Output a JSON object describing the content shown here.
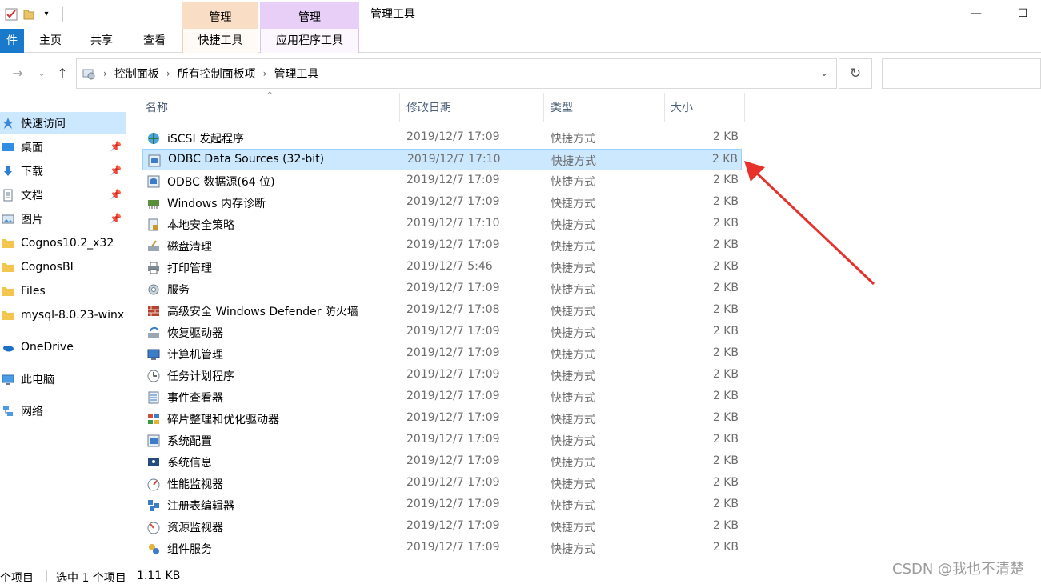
{
  "window": {
    "title": "管理工具",
    "context_tab_manage_1": "管理",
    "context_tab_manage_2": "管理",
    "minimize_glyph": "—",
    "maximize_glyph": "☐"
  },
  "ribbon": {
    "tabs": [
      {
        "label": "件"
      },
      {
        "label": "主页"
      },
      {
        "label": "共享"
      },
      {
        "label": "查看"
      },
      {
        "label": "快捷工具"
      },
      {
        "label": "应用程序工具"
      }
    ]
  },
  "address": {
    "crumbs": [
      "控制面板",
      "所有控制面板项",
      "管理工具"
    ]
  },
  "navpane": {
    "items": [
      {
        "label": "快速访问",
        "icon": "star-icon",
        "pinned": false
      },
      {
        "label": "桌面",
        "icon": "desktop-icon",
        "pinned": true
      },
      {
        "label": "下载",
        "icon": "download-icon",
        "pinned": true
      },
      {
        "label": "文档",
        "icon": "document-icon",
        "pinned": true
      },
      {
        "label": "图片",
        "icon": "pictures-icon",
        "pinned": true
      },
      {
        "label": "Cognos10.2_x32",
        "icon": "folder-icon",
        "pinned": false
      },
      {
        "label": "CognosBI",
        "icon": "folder-icon",
        "pinned": false
      },
      {
        "label": "Files",
        "icon": "folder-icon",
        "pinned": false
      },
      {
        "label": "mysql-8.0.23-winx",
        "icon": "folder-icon",
        "pinned": false
      },
      {
        "label": "OneDrive",
        "icon": "cloud-icon",
        "pinned": false
      },
      {
        "label": "此电脑",
        "icon": "computer-icon",
        "pinned": false
      },
      {
        "label": "网络",
        "icon": "network-icon",
        "pinned": false
      }
    ]
  },
  "columns": {
    "name": "名称",
    "date": "修改日期",
    "type": "类型",
    "size": "大小"
  },
  "files": [
    {
      "name": "iSCSI 发起程序",
      "date": "2019/12/7 17:09",
      "type": "快捷方式",
      "size": "2 KB"
    },
    {
      "name": "ODBC Data Sources (32-bit)",
      "date": "2019/12/7 17:10",
      "type": "快捷方式",
      "size": "2 KB",
      "selected": true
    },
    {
      "name": "ODBC 数据源(64 位)",
      "date": "2019/12/7 17:09",
      "type": "快捷方式",
      "size": "2 KB"
    },
    {
      "name": "Windows 内存诊断",
      "date": "2019/12/7 17:09",
      "type": "快捷方式",
      "size": "2 KB"
    },
    {
      "name": "本地安全策略",
      "date": "2019/12/7 17:10",
      "type": "快捷方式",
      "size": "2 KB"
    },
    {
      "name": "磁盘清理",
      "date": "2019/12/7 17:09",
      "type": "快捷方式",
      "size": "2 KB"
    },
    {
      "name": "打印管理",
      "date": "2019/12/7 5:46",
      "type": "快捷方式",
      "size": "2 KB"
    },
    {
      "name": "服务",
      "date": "2019/12/7 17:09",
      "type": "快捷方式",
      "size": "2 KB"
    },
    {
      "name": "高级安全 Windows Defender 防火墙",
      "date": "2019/12/7 17:08",
      "type": "快捷方式",
      "size": "2 KB"
    },
    {
      "name": "恢复驱动器",
      "date": "2019/12/7 17:09",
      "type": "快捷方式",
      "size": "2 KB"
    },
    {
      "name": "计算机管理",
      "date": "2019/12/7 17:09",
      "type": "快捷方式",
      "size": "2 KB"
    },
    {
      "name": "任务计划程序",
      "date": "2019/12/7 17:09",
      "type": "快捷方式",
      "size": "2 KB"
    },
    {
      "name": "事件查看器",
      "date": "2019/12/7 17:09",
      "type": "快捷方式",
      "size": "2 KB"
    },
    {
      "name": "碎片整理和优化驱动器",
      "date": "2019/12/7 17:09",
      "type": "快捷方式",
      "size": "2 KB"
    },
    {
      "name": "系统配置",
      "date": "2019/12/7 17:09",
      "type": "快捷方式",
      "size": "2 KB"
    },
    {
      "name": "系统信息",
      "date": "2019/12/7 17:09",
      "type": "快捷方式",
      "size": "2 KB"
    },
    {
      "name": "性能监视器",
      "date": "2019/12/7 17:09",
      "type": "快捷方式",
      "size": "2 KB"
    },
    {
      "name": "注册表编辑器",
      "date": "2019/12/7 17:09",
      "type": "快捷方式",
      "size": "2 KB"
    },
    {
      "name": "资源监视器",
      "date": "2019/12/7 17:09",
      "type": "快捷方式",
      "size": "2 KB"
    },
    {
      "name": "组件服务",
      "date": "2019/12/7 17:09",
      "type": "快捷方式",
      "size": "2 KB"
    }
  ],
  "status": {
    "count": "个项目",
    "selection": "选中 1 个项目",
    "size": "1.11 KB"
  },
  "watermark": "CSDN @我也不清楚",
  "colors": {
    "selection_bg": "#cce8ff",
    "selection_border": "#99d1ff",
    "file_tab": "#1979ca",
    "annotation_arrow": "#e8312a"
  }
}
